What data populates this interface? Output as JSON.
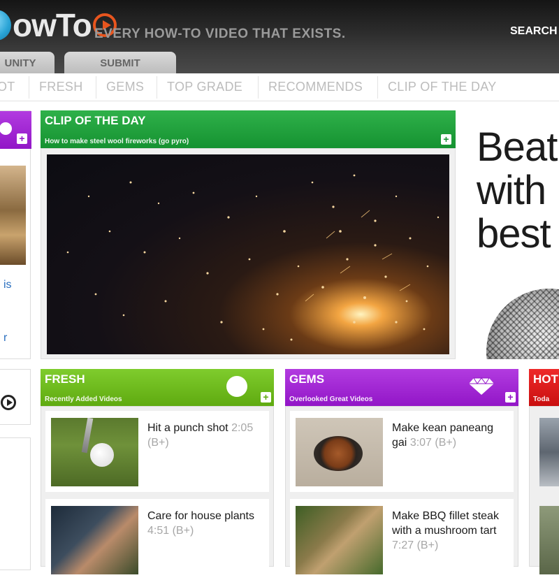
{
  "header": {
    "logo_text": "owTo",
    "tagline": "EVERY HOW-TO VIDEO THAT EXISTS.",
    "search_label": "SEARCH",
    "tabs": [
      "UNITY",
      "SUBMIT"
    ]
  },
  "subnav": {
    "items": [
      "OT",
      "FRESH",
      "GEMS",
      "TOP GRADE",
      "RECOMMENDS",
      "CLIP OF THE DAY"
    ]
  },
  "clip_of_the_day": {
    "title": "CLIP OF THE DAY",
    "subtitle": "How to make steel wool fireworks (go pyro)",
    "plus": "+"
  },
  "ad": {
    "lines": [
      "Beat",
      "with",
      "best"
    ]
  },
  "fresh": {
    "title": "FRESH",
    "subtitle": "Recently Added Videos",
    "plus": "+",
    "items": [
      {
        "title": "Hit a punch shot",
        "duration": "2:05",
        "grade": "(B+)"
      },
      {
        "title": "Care for house plants",
        "duration": "4:51",
        "grade": "(B+)"
      }
    ]
  },
  "gems": {
    "title": "GEMS",
    "subtitle": "Overlooked Great Videos",
    "plus": "+",
    "items": [
      {
        "title": "Make kean paneang gai",
        "duration": "3:07",
        "grade": "(B+)"
      },
      {
        "title": "Make BBQ fillet steak with a mushroom tart",
        "duration": "7:27",
        "grade": "(B+)"
      }
    ]
  },
  "hot": {
    "title": "HOT",
    "subtitle": "Toda"
  },
  "left_column": {
    "link_fragment_1": "is",
    "link_fragment_2": "r"
  },
  "colors": {
    "clip_green": "#1aa038",
    "fresh_green": "#6cb71c",
    "gems_purple": "#a024d4",
    "hot_red": "#e01a1a",
    "header_dark": "#222222"
  }
}
